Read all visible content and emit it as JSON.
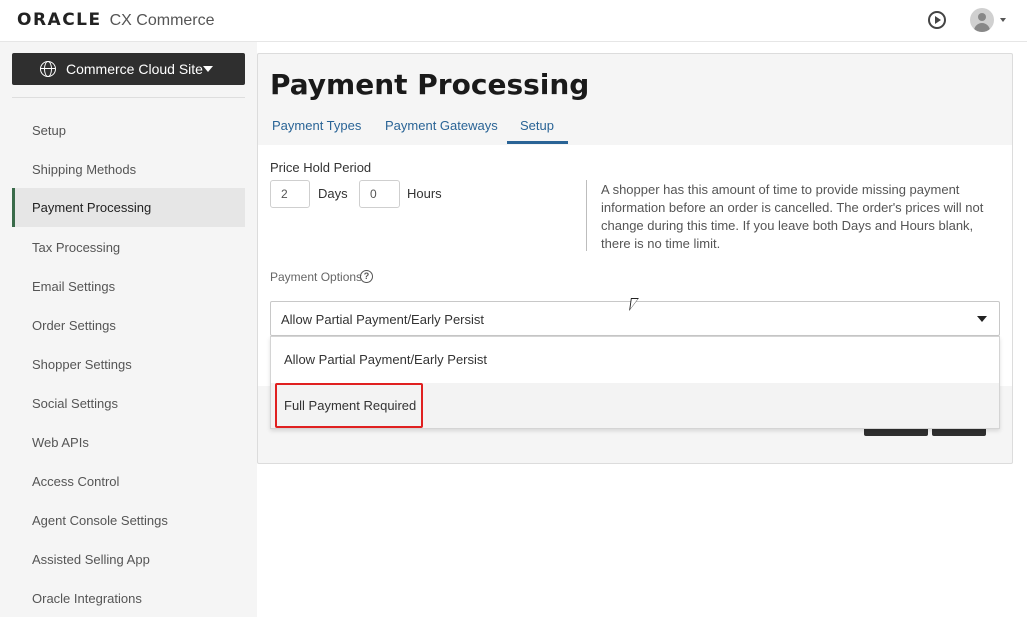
{
  "header": {
    "brand": "ORACLE",
    "product": "CX Commerce"
  },
  "site_selector": {
    "label": "Commerce Cloud Site"
  },
  "sidebar": {
    "items": [
      {
        "label": "Setup"
      },
      {
        "label": "Shipping Methods"
      },
      {
        "label": "Payment Processing",
        "active": true
      },
      {
        "label": "Tax Processing"
      },
      {
        "label": "Email Settings"
      },
      {
        "label": "Order Settings"
      },
      {
        "label": "Shopper Settings"
      },
      {
        "label": "Social Settings"
      },
      {
        "label": "Web APIs"
      },
      {
        "label": "Access Control"
      },
      {
        "label": "Agent Console Settings"
      },
      {
        "label": "Assisted Selling App"
      },
      {
        "label": "Oracle Integrations"
      }
    ]
  },
  "main": {
    "title": "Payment Processing",
    "tabs": [
      {
        "label": "Payment Types"
      },
      {
        "label": "Payment Gateways"
      },
      {
        "label": "Setup",
        "active": true
      }
    ],
    "price_hold": {
      "label": "Price Hold Period",
      "days_value": "2",
      "days_label": "Days",
      "hours_value": "0",
      "hours_label": "Hours",
      "help": "A shopper has this amount of time to provide missing payment information before an order is cancelled. The order's prices will not change during this time. If you leave both Days and Hours blank, there is no time limit."
    },
    "payment_options": {
      "label": "Payment Options",
      "help_icon": "?",
      "selected": "Allow Partial Payment/Early Persist",
      "options": [
        "Allow Partial Payment/Early Persist",
        "Full Payment Required"
      ]
    }
  },
  "colors": {
    "accent": "#2a6496",
    "dark_button": "#2f2f2f",
    "highlight": "#e02020",
    "active_bar": "#3a6b4a"
  }
}
